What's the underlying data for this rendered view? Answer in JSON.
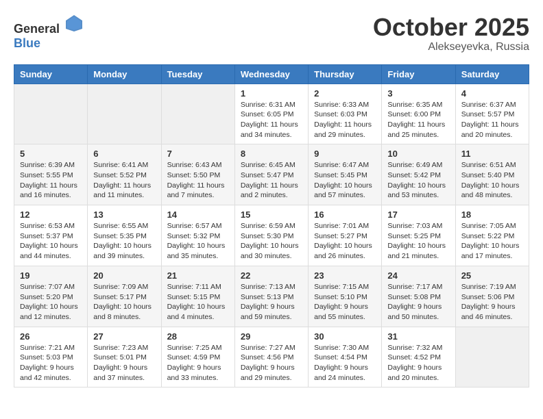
{
  "logo": {
    "text_general": "General",
    "text_blue": "Blue"
  },
  "title": {
    "month": "October 2025",
    "location": "Alekseyevka, Russia"
  },
  "headers": [
    "Sunday",
    "Monday",
    "Tuesday",
    "Wednesday",
    "Thursday",
    "Friday",
    "Saturday"
  ],
  "weeks": [
    [
      {
        "day": "",
        "info": ""
      },
      {
        "day": "",
        "info": ""
      },
      {
        "day": "",
        "info": ""
      },
      {
        "day": "1",
        "info": "Sunrise: 6:31 AM\nSunset: 6:05 PM\nDaylight: 11 hours\nand 34 minutes."
      },
      {
        "day": "2",
        "info": "Sunrise: 6:33 AM\nSunset: 6:03 PM\nDaylight: 11 hours\nand 29 minutes."
      },
      {
        "day": "3",
        "info": "Sunrise: 6:35 AM\nSunset: 6:00 PM\nDaylight: 11 hours\nand 25 minutes."
      },
      {
        "day": "4",
        "info": "Sunrise: 6:37 AM\nSunset: 5:57 PM\nDaylight: 11 hours\nand 20 minutes."
      }
    ],
    [
      {
        "day": "5",
        "info": "Sunrise: 6:39 AM\nSunset: 5:55 PM\nDaylight: 11 hours\nand 16 minutes."
      },
      {
        "day": "6",
        "info": "Sunrise: 6:41 AM\nSunset: 5:52 PM\nDaylight: 11 hours\nand 11 minutes."
      },
      {
        "day": "7",
        "info": "Sunrise: 6:43 AM\nSunset: 5:50 PM\nDaylight: 11 hours\nand 7 minutes."
      },
      {
        "day": "8",
        "info": "Sunrise: 6:45 AM\nSunset: 5:47 PM\nDaylight: 11 hours\nand 2 minutes."
      },
      {
        "day": "9",
        "info": "Sunrise: 6:47 AM\nSunset: 5:45 PM\nDaylight: 10 hours\nand 57 minutes."
      },
      {
        "day": "10",
        "info": "Sunrise: 6:49 AM\nSunset: 5:42 PM\nDaylight: 10 hours\nand 53 minutes."
      },
      {
        "day": "11",
        "info": "Sunrise: 6:51 AM\nSunset: 5:40 PM\nDaylight: 10 hours\nand 48 minutes."
      }
    ],
    [
      {
        "day": "12",
        "info": "Sunrise: 6:53 AM\nSunset: 5:37 PM\nDaylight: 10 hours\nand 44 minutes."
      },
      {
        "day": "13",
        "info": "Sunrise: 6:55 AM\nSunset: 5:35 PM\nDaylight: 10 hours\nand 39 minutes."
      },
      {
        "day": "14",
        "info": "Sunrise: 6:57 AM\nSunset: 5:32 PM\nDaylight: 10 hours\nand 35 minutes."
      },
      {
        "day": "15",
        "info": "Sunrise: 6:59 AM\nSunset: 5:30 PM\nDaylight: 10 hours\nand 30 minutes."
      },
      {
        "day": "16",
        "info": "Sunrise: 7:01 AM\nSunset: 5:27 PM\nDaylight: 10 hours\nand 26 minutes."
      },
      {
        "day": "17",
        "info": "Sunrise: 7:03 AM\nSunset: 5:25 PM\nDaylight: 10 hours\nand 21 minutes."
      },
      {
        "day": "18",
        "info": "Sunrise: 7:05 AM\nSunset: 5:22 PM\nDaylight: 10 hours\nand 17 minutes."
      }
    ],
    [
      {
        "day": "19",
        "info": "Sunrise: 7:07 AM\nSunset: 5:20 PM\nDaylight: 10 hours\nand 12 minutes."
      },
      {
        "day": "20",
        "info": "Sunrise: 7:09 AM\nSunset: 5:17 PM\nDaylight: 10 hours\nand 8 minutes."
      },
      {
        "day": "21",
        "info": "Sunrise: 7:11 AM\nSunset: 5:15 PM\nDaylight: 10 hours\nand 4 minutes."
      },
      {
        "day": "22",
        "info": "Sunrise: 7:13 AM\nSunset: 5:13 PM\nDaylight: 9 hours\nand 59 minutes."
      },
      {
        "day": "23",
        "info": "Sunrise: 7:15 AM\nSunset: 5:10 PM\nDaylight: 9 hours\nand 55 minutes."
      },
      {
        "day": "24",
        "info": "Sunrise: 7:17 AM\nSunset: 5:08 PM\nDaylight: 9 hours\nand 50 minutes."
      },
      {
        "day": "25",
        "info": "Sunrise: 7:19 AM\nSunset: 5:06 PM\nDaylight: 9 hours\nand 46 minutes."
      }
    ],
    [
      {
        "day": "26",
        "info": "Sunrise: 7:21 AM\nSunset: 5:03 PM\nDaylight: 9 hours\nand 42 minutes."
      },
      {
        "day": "27",
        "info": "Sunrise: 7:23 AM\nSunset: 5:01 PM\nDaylight: 9 hours\nand 37 minutes."
      },
      {
        "day": "28",
        "info": "Sunrise: 7:25 AM\nSunset: 4:59 PM\nDaylight: 9 hours\nand 33 minutes."
      },
      {
        "day": "29",
        "info": "Sunrise: 7:27 AM\nSunset: 4:56 PM\nDaylight: 9 hours\nand 29 minutes."
      },
      {
        "day": "30",
        "info": "Sunrise: 7:30 AM\nSunset: 4:54 PM\nDaylight: 9 hours\nand 24 minutes."
      },
      {
        "day": "31",
        "info": "Sunrise: 7:32 AM\nSunset: 4:52 PM\nDaylight: 9 hours\nand 20 minutes."
      },
      {
        "day": "",
        "info": ""
      }
    ]
  ]
}
